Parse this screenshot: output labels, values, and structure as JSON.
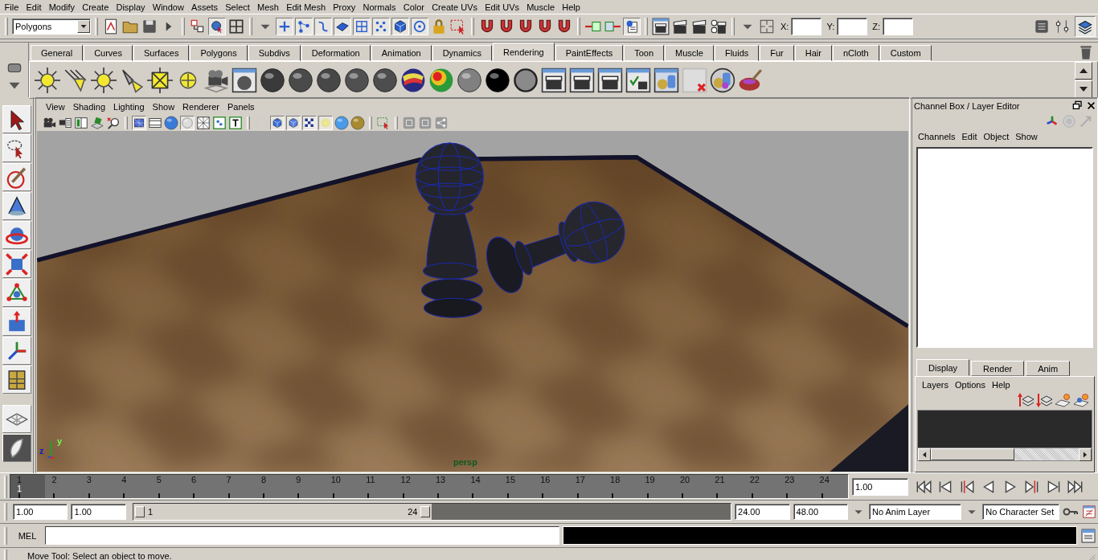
{
  "menu_bar": [
    "File",
    "Edit",
    "Modify",
    "Create",
    "Display",
    "Window",
    "Assets",
    "Select",
    "Mesh",
    "Edit Mesh",
    "Proxy",
    "Normals",
    "Color",
    "Create UVs",
    "Edit UVs",
    "Muscle",
    "Help"
  ],
  "status_line": {
    "mode": "Polygons",
    "coord_labels": [
      "X:",
      "Y:",
      "Z:"
    ]
  },
  "shelf": {
    "tabs": [
      {
        "label": "General",
        "selected": false
      },
      {
        "label": "Curves",
        "selected": false
      },
      {
        "label": "Surfaces",
        "selected": false
      },
      {
        "label": "Polygons",
        "selected": false
      },
      {
        "label": "Subdivs",
        "selected": false
      },
      {
        "label": "Deformation",
        "selected": false
      },
      {
        "label": "Animation",
        "selected": false
      },
      {
        "label": "Dynamics",
        "selected": false
      },
      {
        "label": "Rendering",
        "selected": true
      },
      {
        "label": "PaintEffects",
        "selected": false
      },
      {
        "label": "Toon",
        "selected": false
      },
      {
        "label": "Muscle",
        "selected": false
      },
      {
        "label": "Fluids",
        "selected": false
      },
      {
        "label": "Fur",
        "selected": false
      },
      {
        "label": "Hair",
        "selected": false
      },
      {
        "label": "nCloth",
        "selected": false
      },
      {
        "label": "Custom",
        "selected": false
      }
    ]
  },
  "viewport": {
    "menu": [
      "View",
      "Shading",
      "Lighting",
      "Show",
      "Renderer",
      "Panels"
    ],
    "axis_labels": [
      "z",
      "y"
    ],
    "camera": "persp"
  },
  "channel_box": {
    "title": "Channel Box / Layer Editor",
    "menu": [
      "Channels",
      "Edit",
      "Object",
      "Show"
    ],
    "layer_tabs": [
      {
        "label": "Display",
        "selected": true
      },
      {
        "label": "Render",
        "selected": false
      },
      {
        "label": "Anim",
        "selected": false
      }
    ],
    "layer_menu": [
      "Layers",
      "Options",
      "Help"
    ]
  },
  "time_slider": {
    "ticks": [
      {
        "label": "1",
        "selected": true
      },
      {
        "label": "2",
        "selected": false
      },
      {
        "label": "3",
        "selected": false
      },
      {
        "label": "4",
        "selected": false
      },
      {
        "label": "5",
        "selected": false
      },
      {
        "label": "6",
        "selected": false
      },
      {
        "label": "7",
        "selected": false
      },
      {
        "label": "8",
        "selected": false
      },
      {
        "label": "9",
        "selected": false
      },
      {
        "label": "10",
        "selected": false
      },
      {
        "label": "11",
        "selected": false
      },
      {
        "label": "12",
        "selected": false
      },
      {
        "label": "13",
        "selected": false
      },
      {
        "label": "14",
        "selected": false
      },
      {
        "label": "15",
        "selected": false
      },
      {
        "label": "16",
        "selected": false
      },
      {
        "label": "17",
        "selected": false
      },
      {
        "label": "18",
        "selected": false
      },
      {
        "label": "19",
        "selected": false
      },
      {
        "label": "20",
        "selected": false
      },
      {
        "label": "21",
        "selected": false
      },
      {
        "label": "22",
        "selected": false
      },
      {
        "label": "23",
        "selected": false
      },
      {
        "label": "24",
        "selected": false
      }
    ],
    "current_frame": "1",
    "current_time": "1.00"
  },
  "range_slider": {
    "start_time": "1.00",
    "playback_start": "1.00",
    "range_start": "1",
    "range_end": "24",
    "level": 0.5,
    "playback_end": "24.00",
    "end_time": "48.00",
    "anim_layer": "No Anim Layer",
    "character_set": "No Character Set"
  },
  "command_line": {
    "label": "MEL"
  },
  "help_line": "Move Tool: Select an object to move."
}
